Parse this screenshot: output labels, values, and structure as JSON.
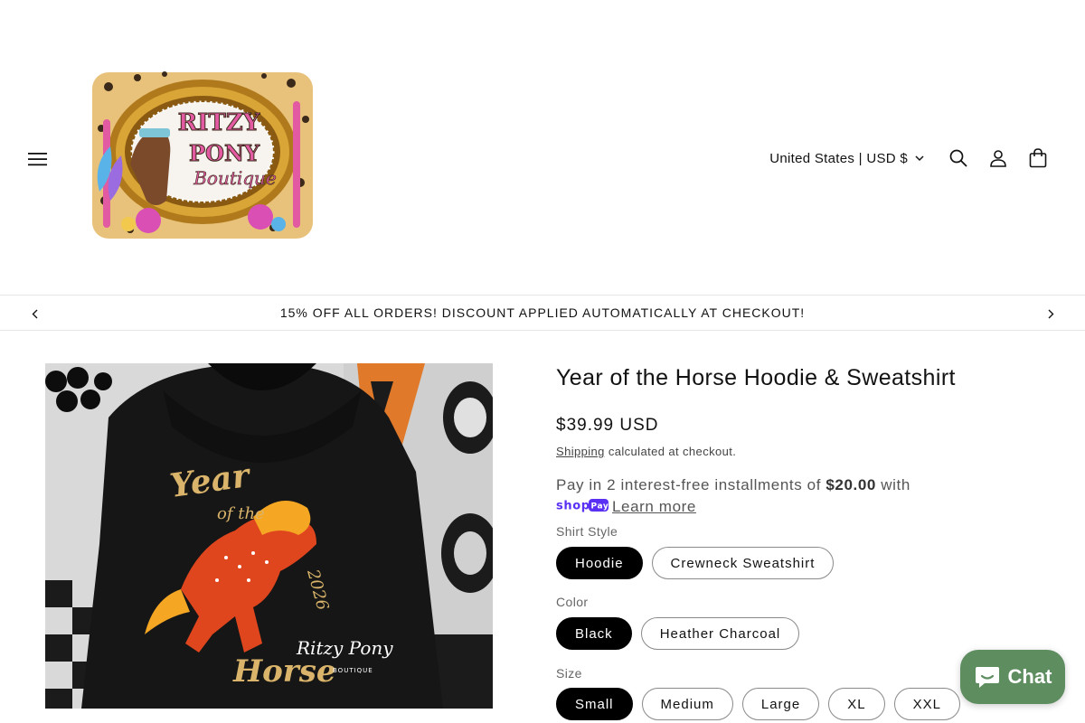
{
  "header": {
    "logo_alt": "Ritzy Pony Boutique",
    "logo_text_lines": [
      "RITZY",
      "PONY",
      "Boutique"
    ],
    "locale_label": "United States | USD $",
    "icons": [
      "hamburger-icon",
      "search-icon",
      "account-icon",
      "cart-icon"
    ]
  },
  "announcement": {
    "text": "15% OFF ALL ORDERS! DISCOUNT APPLIED AUTOMATICALLY AT CHECKOUT!"
  },
  "product": {
    "image_text": {
      "line1": "Year",
      "line2": "of the",
      "line3": "Horse",
      "year": "2026",
      "brand": "Ritzy Pony",
      "brand_sub": "BOUTIQUE"
    },
    "title": "Year of the Horse Hoodie & Sweatshirt",
    "price": "$39.99 USD",
    "shipping_link": "Shipping",
    "shipping_note": " calculated at checkout.",
    "installments_pre": "Pay in 2 interest-free installments of ",
    "installments_amount": "$20.00",
    "installments_post": " with",
    "shoppay_label": "shop Pay",
    "learn_more": "Learn more",
    "options": {
      "style_label": "Shirt Style",
      "styles": [
        "Hoodie",
        "Crewneck Sweatshirt"
      ],
      "color_label": "Color",
      "colors": [
        "Black",
        "Heather Charcoal"
      ],
      "size_label": "Size",
      "sizes": [
        "Small",
        "Medium",
        "Large",
        "XL",
        "XXL"
      ]
    }
  },
  "chat": {
    "label": "Chat"
  },
  "colors": {
    "accent": "#000000",
    "chat_bg": "#5e8d5f",
    "shoppay": "#5a31f4"
  }
}
